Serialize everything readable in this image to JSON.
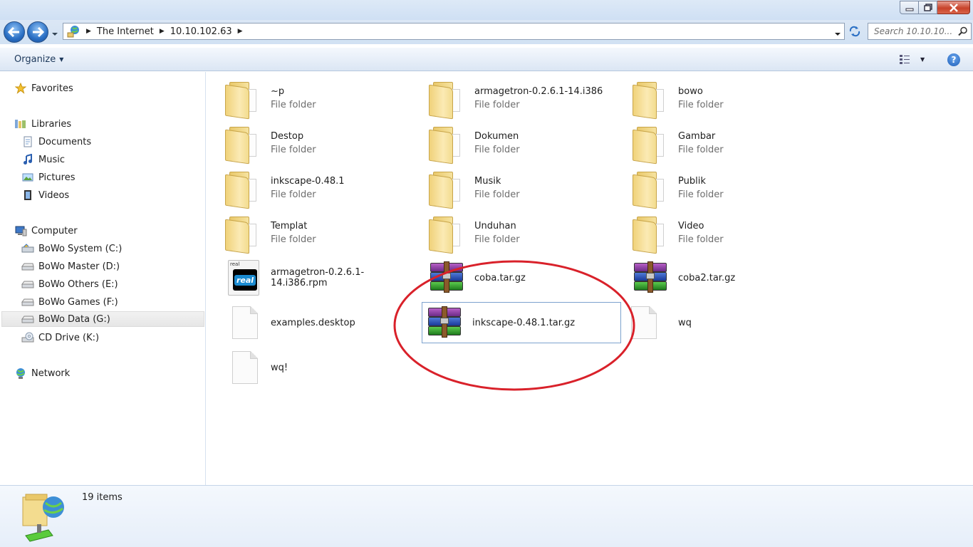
{
  "window": {
    "controls": [
      "minimize",
      "maximize",
      "close"
    ]
  },
  "nav": {
    "breadcrumbs": [
      "The Internet",
      "10.10.102.63"
    ],
    "search_placeholder": "Search 10.10.10..."
  },
  "toolbar": {
    "organize_label": "Organize"
  },
  "sidebar": {
    "favorites": "Favorites",
    "libraries": "Libraries",
    "library_items": [
      "Documents",
      "Music",
      "Pictures",
      "Videos"
    ],
    "computer": "Computer",
    "drives": [
      "BoWo System (C:)",
      "BoWo Master (D:)",
      "BoWo Others (E:)",
      "BoWo Games (F:)",
      "BoWo Data (G:)",
      "CD Drive (K:)"
    ],
    "selected_drive": "BoWo Data (G:)",
    "network": "Network"
  },
  "files": [
    {
      "name": "~p",
      "type": "File folder",
      "icon": "folder-icon"
    },
    {
      "name": "armagetron-0.2.6.1-14.i386",
      "type": "File folder",
      "icon": "folder-icon"
    },
    {
      "name": "bowo",
      "type": "File folder",
      "icon": "folder-icon"
    },
    {
      "name": "Destop",
      "type": "File folder",
      "icon": "folder-icon"
    },
    {
      "name": "Dokumen",
      "type": "File folder",
      "icon": "folder-icon"
    },
    {
      "name": "Gambar",
      "type": "File folder",
      "icon": "folder-icon"
    },
    {
      "name": "inkscape-0.48.1",
      "type": "File folder",
      "icon": "folder-icon"
    },
    {
      "name": "Musik",
      "type": "File folder",
      "icon": "folder-icon"
    },
    {
      "name": "Publik",
      "type": "File folder",
      "icon": "folder-icon"
    },
    {
      "name": "Templat",
      "type": "File folder",
      "icon": "folder-icon"
    },
    {
      "name": "Unduhan",
      "type": "File folder",
      "icon": "folder-icon"
    },
    {
      "name": "Video",
      "type": "File folder",
      "icon": "folder-icon"
    },
    {
      "name": "armagetron-0.2.6.1-14.i386.rpm",
      "type": "",
      "icon": "real-player-icon"
    },
    {
      "name": "coba.tar.gz",
      "type": "",
      "icon": "archive-icon"
    },
    {
      "name": "coba2.tar.gz",
      "type": "",
      "icon": "archive-icon"
    },
    {
      "name": "examples.desktop",
      "type": "",
      "icon": "document-icon"
    },
    {
      "name": "inkscape-0.48.1.tar.gz",
      "type": "",
      "icon": "archive-icon",
      "selected": true
    },
    {
      "name": "wq",
      "type": "",
      "icon": "document-icon"
    },
    {
      "name": "wq!",
      "type": "",
      "icon": "document-icon"
    }
  ],
  "status": {
    "item_count": "19 items"
  },
  "colors": {
    "annotation": "#d9212a",
    "selection_border": "#7da2ce"
  }
}
